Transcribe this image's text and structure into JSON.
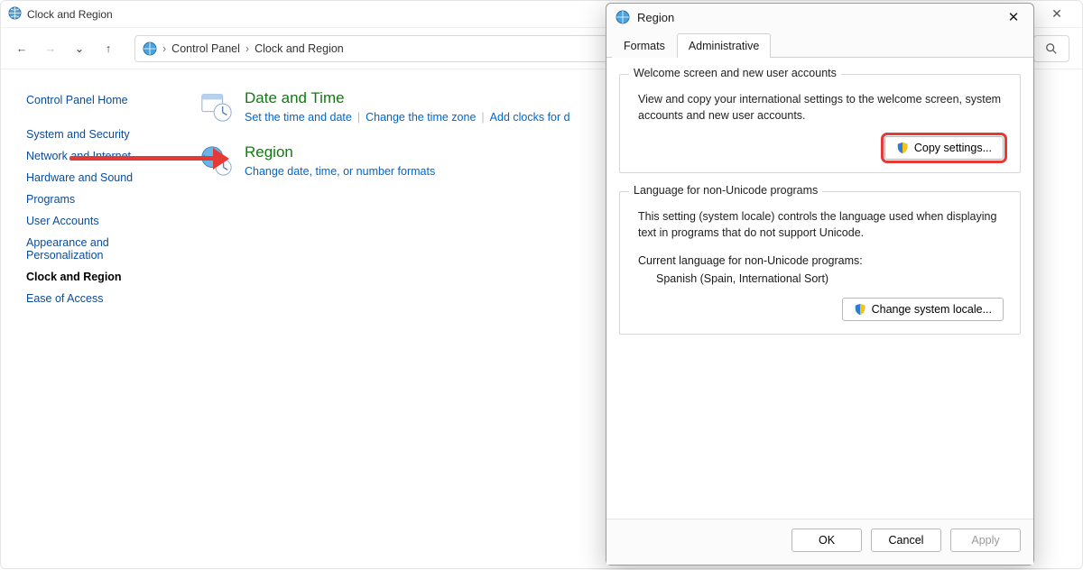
{
  "window": {
    "title": "Clock and Region"
  },
  "breadcrumb": {
    "root": "Control Panel",
    "leaf": "Clock and Region"
  },
  "sidebar": {
    "home": "Control Panel Home",
    "items": [
      "System and Security",
      "Network and Internet",
      "Hardware and Sound",
      "Programs",
      "User Accounts",
      "Appearance and Personalization",
      "Clock and Region",
      "Ease of Access"
    ],
    "current_index": 6
  },
  "categories": {
    "datetime": {
      "title": "Date and Time",
      "links": [
        "Set the time and date",
        "Change the time zone",
        "Add clocks for d"
      ]
    },
    "region": {
      "title": "Region",
      "links": [
        "Change date, time, or number formats"
      ]
    }
  },
  "dialog": {
    "title": "Region",
    "tabs": [
      "Formats",
      "Administrative"
    ],
    "active_tab_index": 1,
    "group1": {
      "title": "Welcome screen and new user accounts",
      "text": "View and copy your international settings to the welcome screen, system accounts and new user accounts.",
      "button": "Copy settings..."
    },
    "group2": {
      "title": "Language for non-Unicode programs",
      "text": "This setting (system locale) controls the language used when displaying text in programs that do not support Unicode.",
      "current_label": "Current language for non-Unicode programs:",
      "current_value": "Spanish (Spain, International Sort)",
      "button": "Change system locale..."
    },
    "footer": {
      "ok": "OK",
      "cancel": "Cancel",
      "apply": "Apply"
    }
  }
}
